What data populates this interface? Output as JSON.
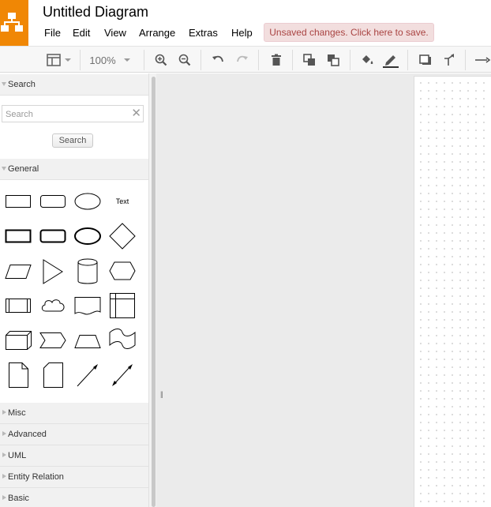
{
  "app": {
    "title": "Untitled Diagram",
    "logo_icon": "drawio-logo-icon",
    "accent_color": "#f08705"
  },
  "menu": {
    "items": [
      {
        "label": "File"
      },
      {
        "label": "Edit"
      },
      {
        "label": "View"
      },
      {
        "label": "Arrange"
      },
      {
        "label": "Extras"
      },
      {
        "label": "Help"
      }
    ]
  },
  "notice": {
    "unsaved": "Unsaved changes. Click here to save.",
    "color": "#a94442",
    "background": "#f2dede"
  },
  "toolbar": {
    "zoom": "100%",
    "icons": [
      "view-panel-icon",
      "zoom-in-icon",
      "zoom-out-icon",
      "undo-icon",
      "redo-icon",
      "delete-icon",
      "to-front-icon",
      "to-back-icon",
      "fill-color-icon",
      "line-color-icon",
      "shadow-icon",
      "waypoint-icon",
      "connection-arrow-icon"
    ]
  },
  "sidebar": {
    "search": {
      "title": "Search",
      "placeholder": "Search",
      "value": "",
      "button_label": "Search",
      "clear_symbol": "✕"
    },
    "general": {
      "title": "General",
      "text_shape_label": "Text",
      "shapes": [
        "rectangle",
        "rounded-rectangle",
        "ellipse",
        "text",
        "rectangle-bold",
        "rounded-rectangle-bold",
        "ellipse-bold",
        "diamond",
        "parallelogram",
        "triangle",
        "cylinder",
        "hexagon",
        "process",
        "cloud",
        "document",
        "internal-storage",
        "cube",
        "step",
        "trapezoid",
        "tape",
        "note",
        "card",
        "line",
        "bidirectional-arrow"
      ]
    },
    "collapsed_sections": [
      "Misc",
      "Advanced",
      "UML",
      "Entity Relation",
      "Basic"
    ]
  },
  "canvas": {
    "splitter_symbol": "||"
  }
}
